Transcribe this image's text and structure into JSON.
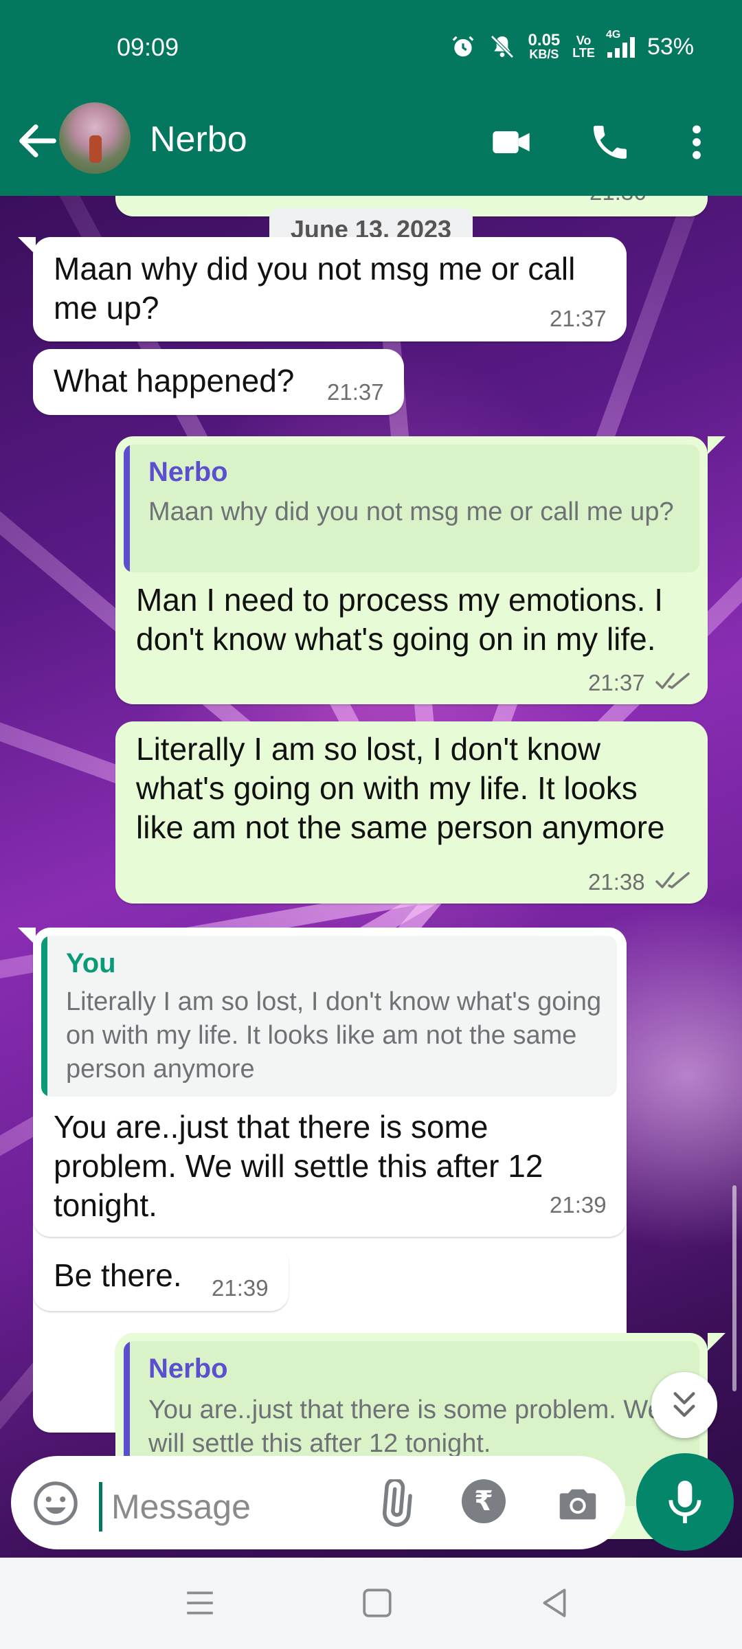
{
  "status_bar": {
    "time": "09:09",
    "data_rate": "0.05",
    "data_unit": "KB/S",
    "volte_top": "Vo",
    "volte_bottom": "LTE",
    "network": "4G",
    "battery": "53%"
  },
  "header": {
    "contact_name": "Nerbo"
  },
  "chat": {
    "date_chip": "June 13, 2023",
    "prev_time_partial": "21:36",
    "messages": [
      {
        "direction": "in",
        "text": "Maan why did you not msg me or call me up?",
        "time": "21:37"
      },
      {
        "direction": "in",
        "text": "What happened?",
        "time": "21:37"
      },
      {
        "direction": "out",
        "quote_author": "Nerbo",
        "quote_text": "Maan why did you not msg me or call me up?",
        "text": "Man I need to process my emotions. I don't know what's going on in my life.",
        "time": "21:37",
        "status": "read"
      },
      {
        "direction": "out",
        "text": "Literally I am so lost, I don't know what's going on with my life. It looks like am not the same person anymore",
        "time": "21:38",
        "status": "read"
      },
      {
        "direction": "in",
        "quote_author": "You",
        "quote_text": "Literally I am so lost, I don't know what's going on with my life. It looks like am not the same person anymore",
        "text": "You are..just that there is some problem. We will settle this after 12 tonight.",
        "time": "21:39"
      },
      {
        "direction": "in",
        "text": "Be there.",
        "time": "21:39"
      },
      {
        "direction": "out",
        "quote_author": "Nerbo",
        "quote_text": "You are..just that there is some problem. We will settle this after 12 tonight."
      }
    ]
  },
  "composer": {
    "placeholder": "Message"
  },
  "colors": {
    "brand": "#04775f",
    "outgoing_bubble": "#e7fcd6",
    "incoming_bubble": "#ffffff",
    "quote_author_nerbo": "#5b4fcf",
    "quote_author_you": "#0a9a78",
    "read_ticks": "#7a7a7a"
  }
}
